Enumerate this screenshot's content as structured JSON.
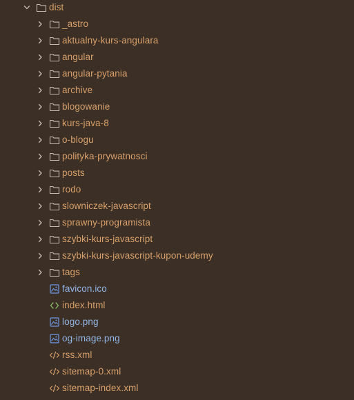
{
  "colors": {
    "background": "#3b2f26",
    "folder_label": "#d9a06a",
    "image_file_label": "#93b6e8",
    "folder_icon": "#c9bcae",
    "image_icon": "#6f9be6",
    "html_icon": "#8fbf6a",
    "xml_icon": "#d9a06a",
    "chevron": "#c9bcae"
  },
  "root": {
    "name": "dist",
    "expanded": true,
    "icon": "folder-icon"
  },
  "items": [
    {
      "name": "_astro",
      "type": "folder",
      "icon": "folder-icon"
    },
    {
      "name": "aktualny-kurs-angulara",
      "type": "folder",
      "icon": "folder-icon"
    },
    {
      "name": "angular",
      "type": "folder",
      "icon": "folder-icon"
    },
    {
      "name": "angular-pytania",
      "type": "folder",
      "icon": "folder-icon"
    },
    {
      "name": "archive",
      "type": "folder",
      "icon": "folder-icon"
    },
    {
      "name": "blogowanie",
      "type": "folder",
      "icon": "folder-icon"
    },
    {
      "name": "kurs-java-8",
      "type": "folder",
      "icon": "folder-icon"
    },
    {
      "name": "o-blogu",
      "type": "folder",
      "icon": "folder-icon"
    },
    {
      "name": "polityka-prywatnosci",
      "type": "folder",
      "icon": "folder-icon"
    },
    {
      "name": "posts",
      "type": "folder",
      "icon": "folder-icon"
    },
    {
      "name": "rodo",
      "type": "folder",
      "icon": "folder-icon"
    },
    {
      "name": "slowniczek-javascript",
      "type": "folder",
      "icon": "folder-icon"
    },
    {
      "name": "sprawny-programista",
      "type": "folder",
      "icon": "folder-icon"
    },
    {
      "name": "szybki-kurs-javascript",
      "type": "folder",
      "icon": "folder-icon"
    },
    {
      "name": "szybki-kurs-javascript-kupon-udemy",
      "type": "folder",
      "icon": "folder-icon"
    },
    {
      "name": "tags",
      "type": "folder",
      "icon": "folder-icon"
    },
    {
      "name": "favicon.ico",
      "type": "image",
      "icon": "image-file-icon"
    },
    {
      "name": "index.html",
      "type": "html",
      "icon": "html-file-icon"
    },
    {
      "name": "logo.png",
      "type": "image",
      "icon": "image-file-icon"
    },
    {
      "name": "og-image.png",
      "type": "image",
      "icon": "image-file-icon"
    },
    {
      "name": "rss.xml",
      "type": "xml",
      "icon": "xml-file-icon"
    },
    {
      "name": "sitemap-0.xml",
      "type": "xml",
      "icon": "xml-file-icon"
    },
    {
      "name": "sitemap-index.xml",
      "type": "xml",
      "icon": "xml-file-icon"
    }
  ]
}
